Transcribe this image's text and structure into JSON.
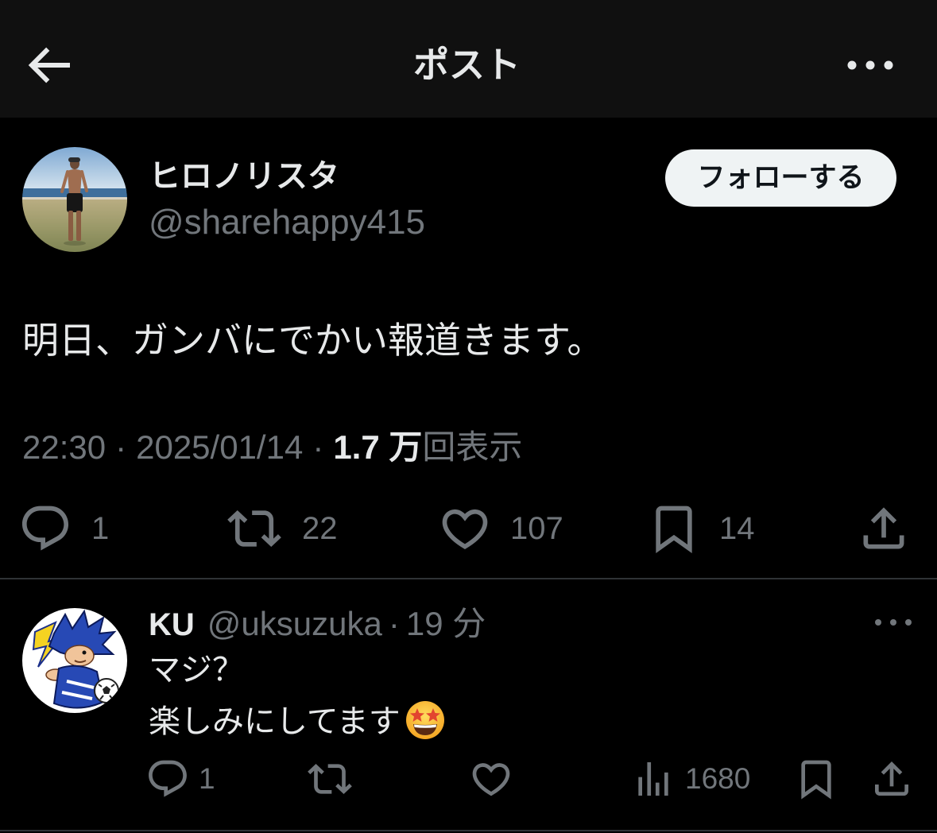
{
  "header": {
    "title": "ポスト",
    "back_icon": "back-arrow-icon",
    "more_icon": "more-icon"
  },
  "post": {
    "author": {
      "display_name": "ヒロノリスタ",
      "handle": "@sharehappy415",
      "avatar": "beach-photo-avatar"
    },
    "follow_label": "フォローする",
    "text": "明日、ガンバにでかい報道きます。",
    "time": "22:30",
    "date": "2025/01/14",
    "separator": "·",
    "views_count": "1.7 万",
    "views_label": "回表示",
    "actions": [
      {
        "icon": "reply-icon",
        "count": "1"
      },
      {
        "icon": "repost-icon",
        "count": "22"
      },
      {
        "icon": "like-icon",
        "count": "107"
      },
      {
        "icon": "bookmark-icon",
        "count": "14"
      },
      {
        "icon": "share-icon"
      }
    ]
  },
  "reply": {
    "author": {
      "display_name": "KU",
      "handle": "@uksuzuka",
      "avatar": "cartoon-character-avatar"
    },
    "separator": "·",
    "age": "19 分",
    "lines": [
      "マジ？",
      "楽しみにしてます"
    ],
    "trailing_emoji": "star-struck-emoji",
    "more_icon": "more-icon",
    "actions": [
      {
        "icon": "reply-icon",
        "count": "1"
      },
      {
        "icon": "repost-icon"
      },
      {
        "icon": "like-icon"
      },
      {
        "icon": "views-icon",
        "count": "1680"
      },
      {
        "icon": "bookmark-icon"
      },
      {
        "icon": "share-icon"
      }
    ]
  },
  "theme": {
    "background": "#000000",
    "header_background": "#101010",
    "primary_text": "#e7e9ea",
    "secondary_text": "#71767b",
    "divider": "#2f3336",
    "follow_button_background": "#eff3f4",
    "follow_button_text": "#0f1419"
  }
}
